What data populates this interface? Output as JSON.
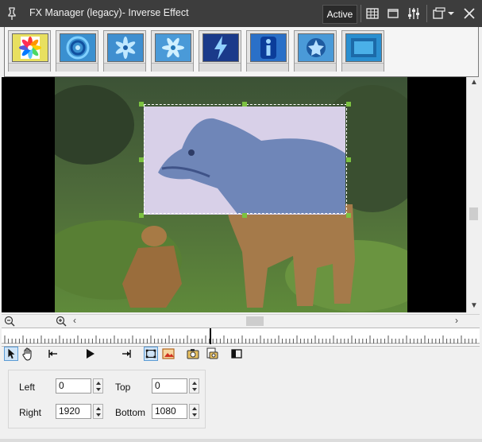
{
  "window": {
    "title": "FX Manager (legacy)- Inverse Effect",
    "mode_button": "Active"
  },
  "icons": {
    "pin": "pin-icon",
    "grid": "grid-view-icon",
    "window": "window-icon",
    "sliders": "sliders-icon",
    "layout": "layout-menu-icon",
    "close": "close-icon"
  },
  "effects": [
    {
      "name": "color-wheel-effect",
      "colors": [
        "#e8e060",
        "#ff7f00",
        "#1e90ff"
      ]
    },
    {
      "name": "swirl-effect",
      "colors": [
        "#3aa0d8",
        "#1050a0",
        "#7fd0ff"
      ]
    },
    {
      "name": "flower-effect",
      "colors": [
        "#5fb0e0",
        "#2070b0",
        "#c0e8ff"
      ]
    },
    {
      "name": "flower-effect-2",
      "colors": [
        "#6fbde6",
        "#2278b8",
        "#d0f0ff"
      ]
    },
    {
      "name": "bolt-effect",
      "colors": [
        "#1a3a8a",
        "#8fd0ff",
        "#0a1a50"
      ]
    },
    {
      "name": "info-effect",
      "colors": [
        "#2a70c8",
        "#0b3d9a",
        "#9fd6ff"
      ]
    },
    {
      "name": "star-effect",
      "colors": [
        "#4a9ad8",
        "#1e5aa0",
        "#b8e0ff"
      ]
    },
    {
      "name": "blank-effect",
      "colors": [
        "#2a8fd0",
        "#1c6aa8",
        "#4ab0e8"
      ]
    }
  ],
  "properties": {
    "left_label": "Left",
    "left_value": "0",
    "top_label": "Top",
    "top_value": "0",
    "right_label": "Right",
    "right_value": "1920",
    "bottom_label": "Bottom",
    "bottom_value": "1080"
  },
  "colors": {
    "titlebar": "#3d3d3d",
    "handle": "#7cc241",
    "selection_tint": "#c8d8ff"
  }
}
